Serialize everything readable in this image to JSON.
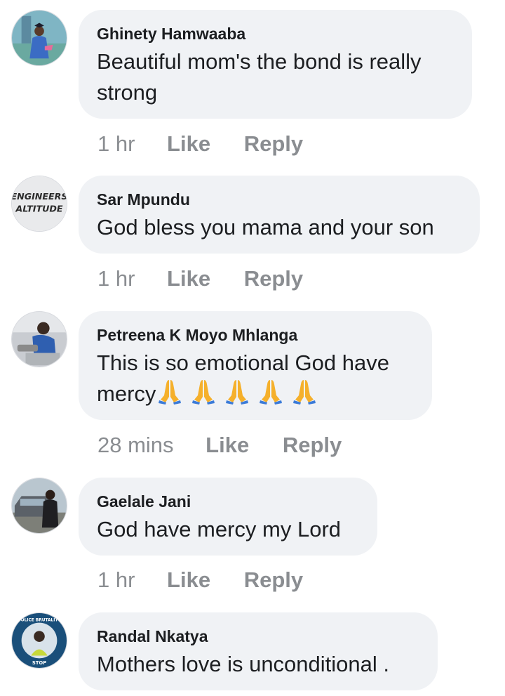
{
  "comments": [
    {
      "author": "Ghinety Hamwaaba",
      "text_lines": [
        "Beautiful mom's the bond is really",
        "strong"
      ],
      "time": "1 hr",
      "like_label": "Like",
      "reply_label": "Reply"
    },
    {
      "author": "Sar Mpundu",
      "text_lines": [
        "God bless you mama and your son"
      ],
      "time": "1 hr",
      "like_label": "Like",
      "reply_label": "Reply",
      "avatar_text": [
        "ENGINEERS",
        "ALTITUDE"
      ]
    },
    {
      "author": "Petreena K Moyo Mhlanga",
      "text_lines": [
        "This is so emotional God have",
        "mercy"
      ],
      "emoji": "folded-hands-icon",
      "emoji_count": 5,
      "time": "28 mins",
      "like_label": "Like",
      "reply_label": "Reply"
    },
    {
      "author": "Gaelale Jani",
      "text_lines": [
        "God have mercy my Lord"
      ],
      "time": "1 hr",
      "like_label": "Like",
      "reply_label": "Reply"
    },
    {
      "author": "Randal Nkatya",
      "text_lines": [
        "Mothers love is unconditional ."
      ],
      "avatar_text": [
        "POLICE BRUTALITY",
        "STOP"
      ]
    }
  ],
  "colors": {
    "bubble_bg": "#f0f2f5",
    "primary_text": "#1c1e21",
    "secondary_text": "#8a8d91"
  }
}
